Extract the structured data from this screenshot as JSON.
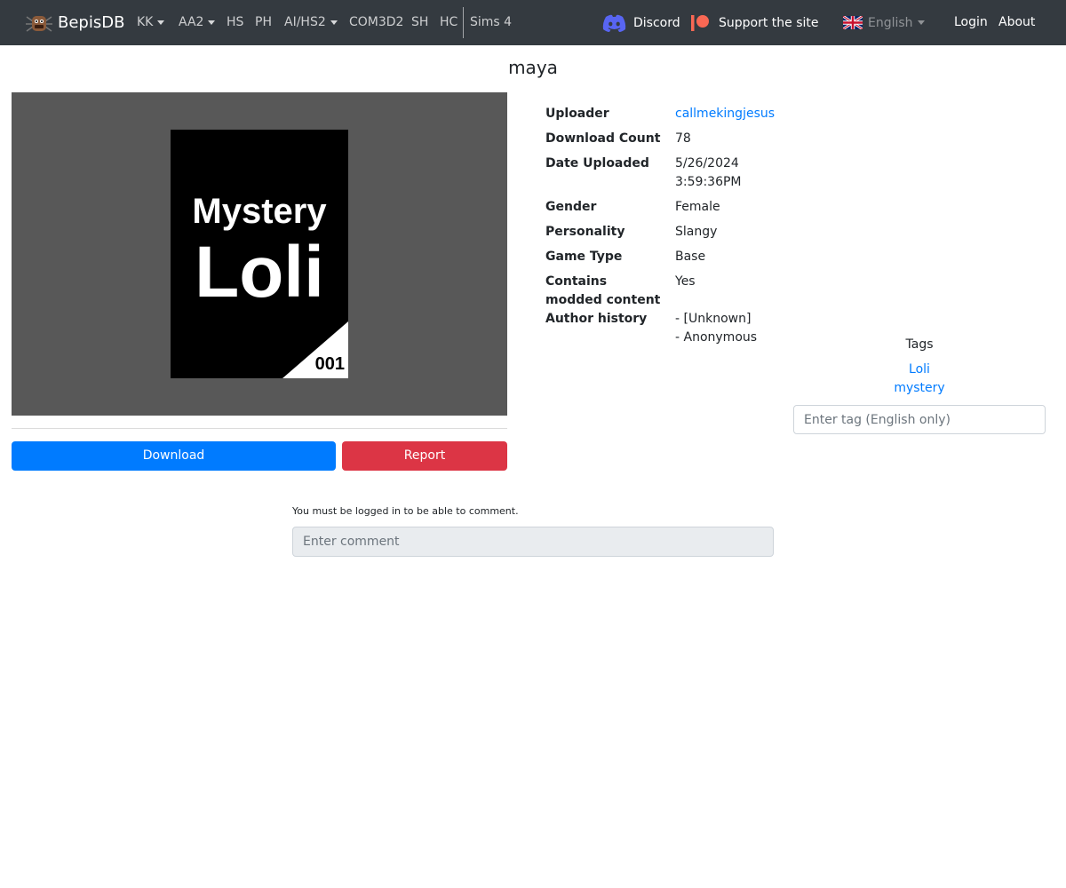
{
  "navbar": {
    "brand": "BepisDB",
    "menu": [
      {
        "label": "KK",
        "has_dropdown": true
      },
      {
        "label": "AA2",
        "has_dropdown": true
      },
      {
        "label": "HS",
        "has_dropdown": false
      },
      {
        "label": "PH",
        "has_dropdown": false
      },
      {
        "label": "AI/HS2",
        "has_dropdown": true
      },
      {
        "label": "COM3D2",
        "has_dropdown": false
      },
      {
        "label": "SH",
        "has_dropdown": false
      },
      {
        "label": "HC",
        "has_dropdown": false
      },
      {
        "label": "Sims 4",
        "has_dropdown": false
      }
    ],
    "discord": "Discord",
    "support": "Support the site",
    "language": "English",
    "login": "Login",
    "about": "About"
  },
  "card": {
    "title": "maya",
    "image": {
      "line1": "Mystery",
      "line2": "Loli",
      "number": "001"
    },
    "download_label": "Download",
    "report_label": "Report"
  },
  "info": [
    {
      "label": "Uploader",
      "value": "callmekingjesus",
      "is_link": true
    },
    {
      "label": "Download Count",
      "value": "78"
    },
    {
      "label": "Date Uploaded",
      "value_lines": [
        "5/26/2024",
        "3:59:36PM"
      ]
    },
    {
      "label": "Gender",
      "value": "Female"
    },
    {
      "label": "Personality",
      "value": "Slangy"
    },
    {
      "label": "Game Type",
      "value": "Base"
    },
    {
      "label_lines": [
        "Contains",
        "modded content"
      ],
      "value": "Yes"
    },
    {
      "label": "Author history",
      "value_lines": [
        "- [Unknown]",
        "- Anonymous"
      ]
    }
  ],
  "tags": {
    "title": "Tags",
    "items": [
      "Loli",
      "mystery"
    ],
    "input_placeholder": "Enter tag (English only)"
  },
  "comments": {
    "note": "You must be logged in to be able to comment.",
    "placeholder": "Enter comment"
  },
  "colors": {
    "navbar_bg": "#343a40",
    "primary": "#007bff",
    "danger": "#dc3545",
    "discord": "#5865f2",
    "patreon": "#f96854"
  },
  "icons": [
    "bepis-logo-icon",
    "discord-icon",
    "patreon-icon",
    "uk-flag-icon"
  ]
}
